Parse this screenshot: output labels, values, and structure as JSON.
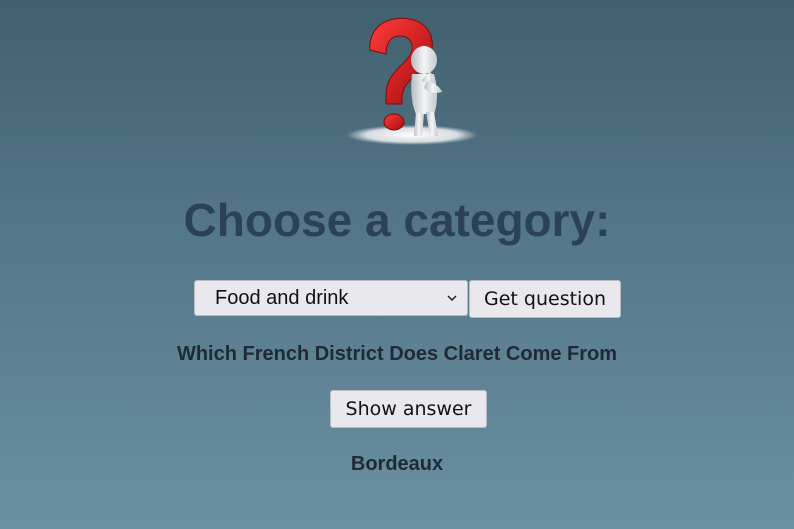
{
  "hero": {
    "icon": "question-mark-thinking-figure-icon",
    "accent_color": "#d11a1a"
  },
  "page": {
    "title": "Choose a category:"
  },
  "category_select": {
    "selected": "Food and drink"
  },
  "buttons": {
    "get_question": "Get question",
    "show_answer": "Show answer"
  },
  "question": {
    "text": "Which French District Does Claret Come From"
  },
  "answer": {
    "text": "Bordeaux"
  },
  "colors": {
    "background_top": "#41606e",
    "background_bottom": "#6a90a2",
    "title": "#2b4256"
  }
}
